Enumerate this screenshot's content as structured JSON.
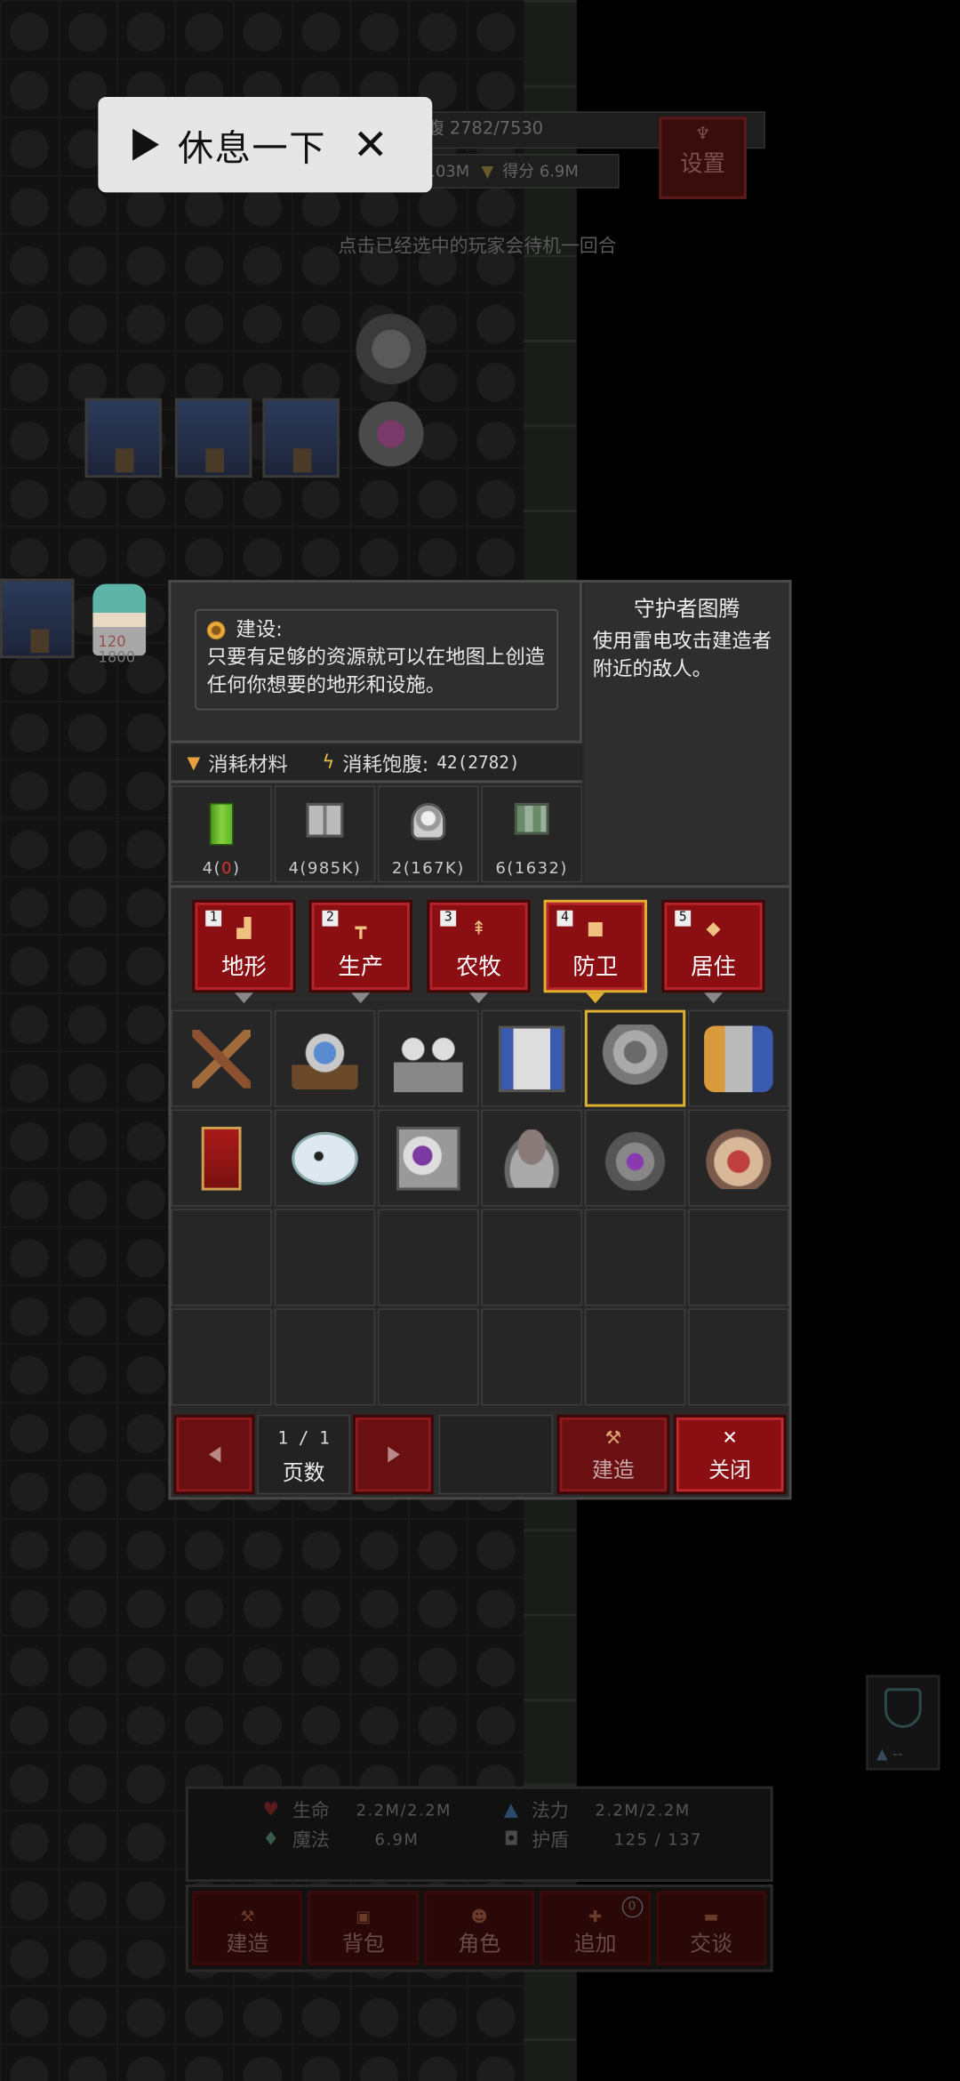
{
  "hud": {
    "satiety": "饱腹 2782/7530",
    "gold": "金币 103M",
    "score": "得分 6.9M",
    "settings_label": "设置",
    "hint": "点击已经选中的玩家会待机一回合"
  },
  "pause": {
    "label": "休息一下"
  },
  "player": {
    "hp": "120",
    "max": "1800"
  },
  "build_panel": {
    "info_title": "建设:",
    "info_text": "只要有足够的资源就可以在地图上创造任何你想要的地形和设施。",
    "selected_name": "守护者图腾",
    "selected_desc": "使用雷电攻击建造者附近的敌人。",
    "cost_materials_label": "消耗材料",
    "cost_satiety_label": "消耗饱腹:",
    "cost_satiety_value": "42(2782)",
    "materials": [
      {
        "icon": "green-crystal-icon",
        "need": "4",
        "have": "0"
      },
      {
        "icon": "book-icon",
        "need": "4",
        "have": "985K"
      },
      {
        "icon": "seal-icon",
        "need": "2",
        "have": "167K"
      },
      {
        "icon": "map-scroll-icon",
        "need": "6",
        "have": "1632"
      }
    ],
    "tabs": [
      {
        "num": "1",
        "label": "地形",
        "icon": "▟"
      },
      {
        "num": "2",
        "label": "生产",
        "icon": "┳"
      },
      {
        "num": "3",
        "label": "农牧",
        "icon": "⇞"
      },
      {
        "num": "4",
        "label": "防卫",
        "icon": "■"
      },
      {
        "num": "5",
        "label": "居住",
        "icon": "◆"
      }
    ],
    "selected_tab": "4",
    "buildings": [
      "crossed-sticks",
      "ballista",
      "twin-towers",
      "blue-fort",
      "guardian-totem",
      "cannon",
      "war-banner",
      "ice-whale",
      "purple-box",
      "stone-anvil",
      "mech-turret",
      "beast-altar"
    ],
    "page_current": "1",
    "page_total": "1",
    "page_label": "页数",
    "build_label": "建造",
    "close_label": "关闭"
  },
  "stats": {
    "hp_label": "生命",
    "hp_value": "2.2M/2.2M",
    "mp_label": "法力",
    "mp_value": "2.2M/2.2M",
    "magic_label": "魔法",
    "magic_value": "6.9M",
    "shield_label": "护盾",
    "shield_value": "125 / 137"
  },
  "nav": [
    {
      "label": "建造"
    },
    {
      "label": "背包"
    },
    {
      "label": "角色"
    },
    {
      "label": "追加",
      "badge": "0"
    },
    {
      "label": "交谈"
    }
  ],
  "side_widget": {
    "label": "--"
  }
}
